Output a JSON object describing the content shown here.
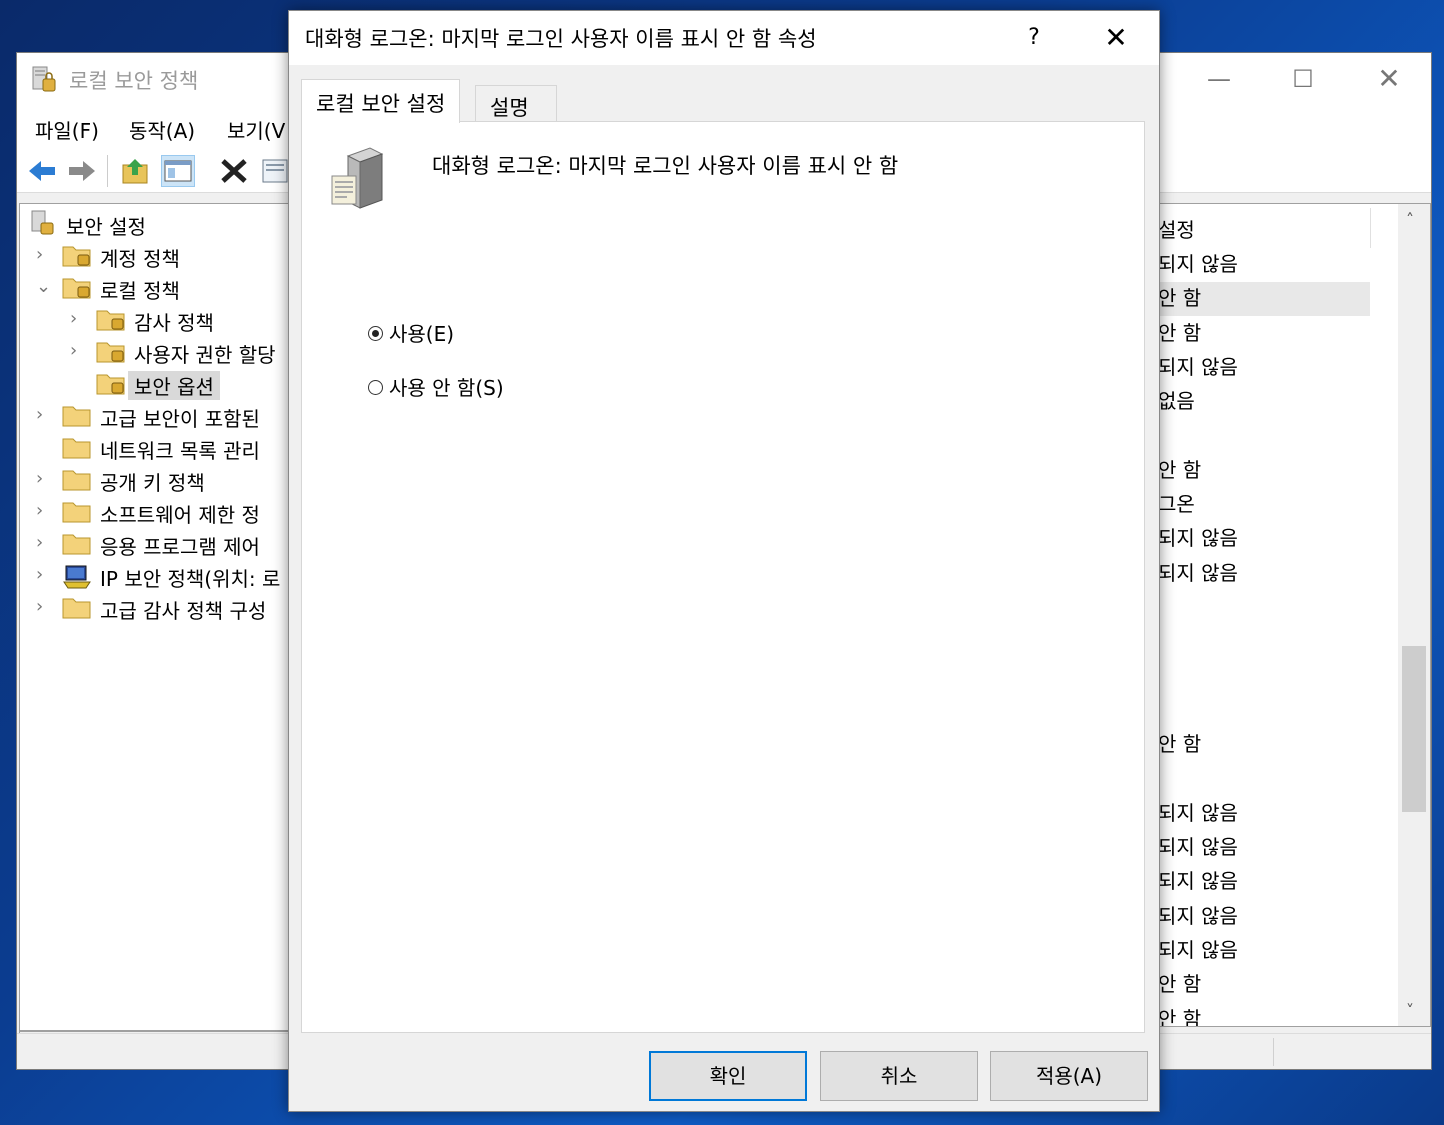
{
  "mmc": {
    "title": "로컬 보안 정책",
    "window_controls": {
      "minimize": "—",
      "maximize": "☐",
      "close": "✕"
    },
    "menu": [
      "파일(F)",
      "동작(A)",
      "보기(V"
    ],
    "tree": {
      "items": [
        {
          "label": "보안 설정",
          "chevron": ""
        },
        {
          "label": "계정 정책",
          "chevron": "›"
        },
        {
          "label": "로컬 정책",
          "chevron": "⌄"
        },
        {
          "label": "감사 정책",
          "chevron": "›"
        },
        {
          "label": "사용자 권한 할당",
          "chevron": "›"
        },
        {
          "label": "보안 옵션",
          "chevron": ""
        },
        {
          "label": "고급 보안이 포함된",
          "chevron": "›"
        },
        {
          "label": "네트워크 목록 관리",
          "chevron": ""
        },
        {
          "label": "공개 키 정책",
          "chevron": "›"
        },
        {
          "label": "소프트웨어 제한 정",
          "chevron": "›"
        },
        {
          "label": "응용 프로그램 제어",
          "chevron": "›"
        },
        {
          "label": "IP 보안 정책(위치: 로",
          "chevron": "›"
        },
        {
          "label": "고급 감사 정책 구성",
          "chevron": "›"
        }
      ]
    },
    "list": {
      "header": "설정",
      "rows": [
        "되지 않음",
        "안 함",
        "안 함",
        "되지 않음",
        "없음",
        "",
        "안 함",
        "그온",
        "되지 않음",
        "되지 않음",
        "",
        "",
        "",
        "",
        "안 함",
        "",
        "되지 않음",
        "되지 않음",
        "되지 않음",
        "되지 않음",
        "되지 않음",
        "안 함",
        "안 함"
      ]
    },
    "scroll": {
      "left": "‹",
      "up": "˄",
      "down": "˅"
    }
  },
  "dialog": {
    "title": "대화형 로그온: 마지막 로그인 사용자 이름 표시 안 함 속성",
    "help": "?",
    "close": "✕",
    "tabs": [
      "로컬 보안 설정",
      "설명"
    ],
    "policy_name": "대화형 로그온: 마지막 로그인 사용자 이름 표시 안 함",
    "options": [
      {
        "label": "사용(E)",
        "checked": true
      },
      {
        "label": "사용 안 함(S)",
        "checked": false
      }
    ],
    "buttons": {
      "ok": "확인",
      "cancel": "취소",
      "apply": "적용(A)"
    }
  }
}
